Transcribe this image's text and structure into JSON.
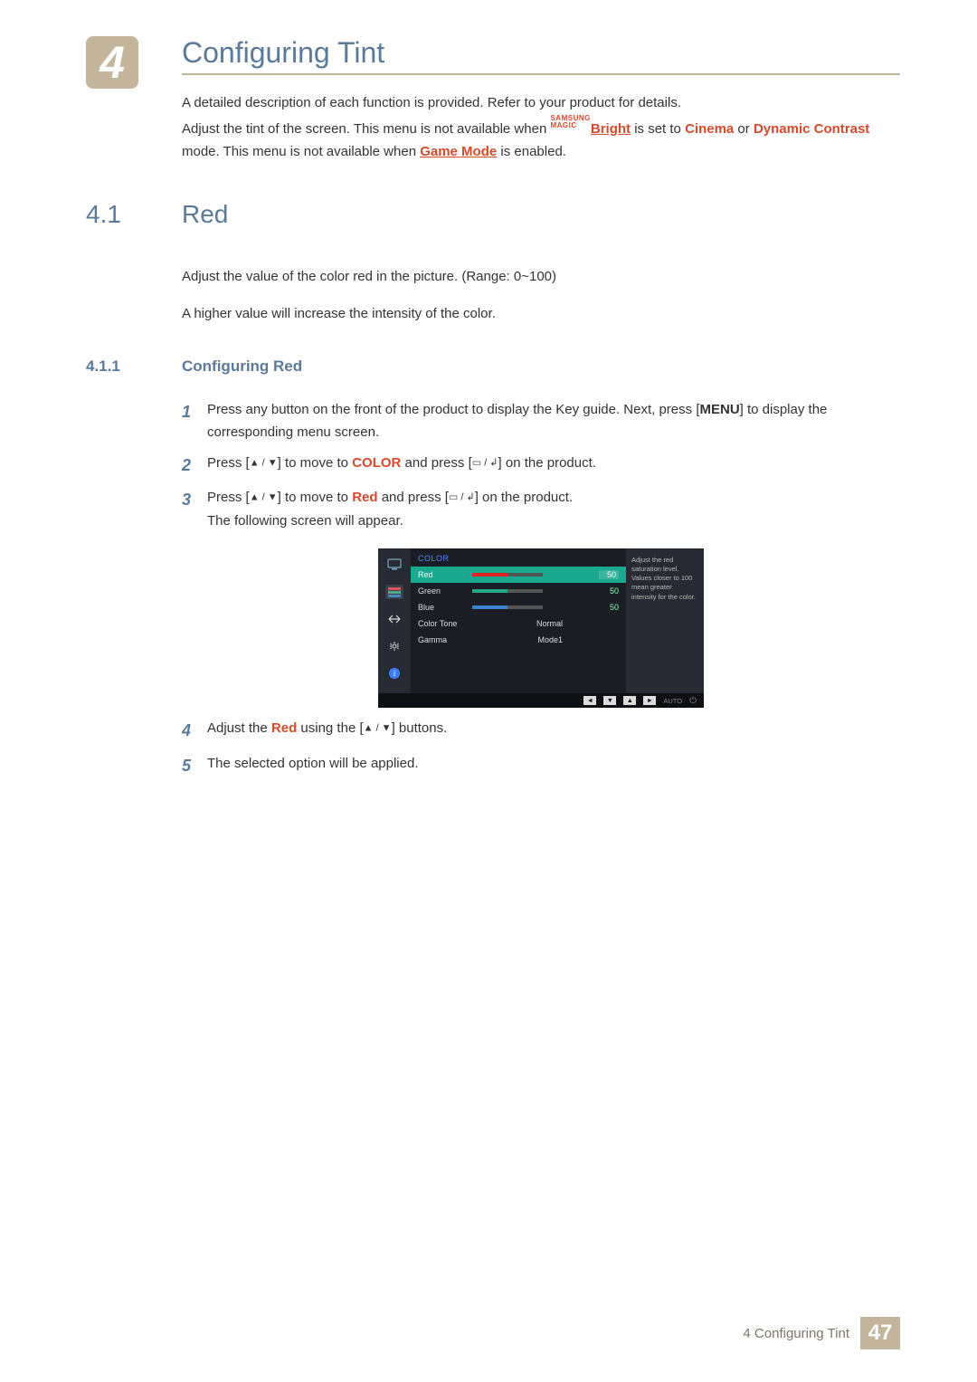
{
  "chapter": {
    "number": "4",
    "title": "Configuring Tint"
  },
  "intro": {
    "p1": "A detailed description of each function is provided. Refer to your product for details.",
    "p2_a": "Adjust the tint of the screen. This menu is not available when ",
    "magic_top": "SAMSUNG",
    "magic_bot": "MAGIC",
    "bright": "Bright",
    "p2_b": " is set to ",
    "cinema": "Cinema",
    "p2_c": " or ",
    "dyn": "Dynamic Contrast",
    "p2_d": " mode. This menu is not available when ",
    "game": "Game Mode",
    "p2_e": " is enabled."
  },
  "section": {
    "number": "4.1",
    "title": "Red"
  },
  "sec_body": {
    "p1": "Adjust the value of the color red in the picture. (Range: 0~100)",
    "p2": "A higher value will increase the intensity of the color."
  },
  "subsection": {
    "number": "4.1.1",
    "title": "Configuring Red"
  },
  "steps": {
    "s1_a": "Press any button on the front of the product to display the Key guide. Next, press [",
    "menu": "MENU",
    "s1_b": "] to display the corresponding menu screen.",
    "s2_a": "Press [",
    "s2_b": "] to move to ",
    "color": "COLOR",
    "s2_c": " and press [",
    "s2_d": "] on the product.",
    "s3_a": "Press [",
    "s3_b": "] to move to ",
    "red": "Red",
    "s3_c": " and press [",
    "s3_d": "] on the product.",
    "s3_e": "The following screen will appear.",
    "s4_a": "Adjust the ",
    "s4_b": " using the [",
    "s4_c": "] buttons.",
    "s5": "The selected option will be applied."
  },
  "osd": {
    "title": "COLOR",
    "rows": {
      "red": {
        "label": "Red",
        "value": "50",
        "fill": 50,
        "color": "#d22"
      },
      "green": {
        "label": "Green",
        "value": "50",
        "fill": 50,
        "color": "#2a8"
      },
      "blue": {
        "label": "Blue",
        "value": "50",
        "fill": 50,
        "color": "#3a7fd0"
      },
      "ctone": {
        "label": "Color Tone",
        "value": "Normal"
      },
      "gamma": {
        "label": "Gamma",
        "value": "Mode1"
      }
    },
    "tip": "Adjust the red saturation level. Values closer to 100 mean greater intensity for the color.",
    "bottom": {
      "auto": "AUTO"
    }
  },
  "footer": {
    "label": "4 Configuring Tint",
    "page": "47"
  }
}
